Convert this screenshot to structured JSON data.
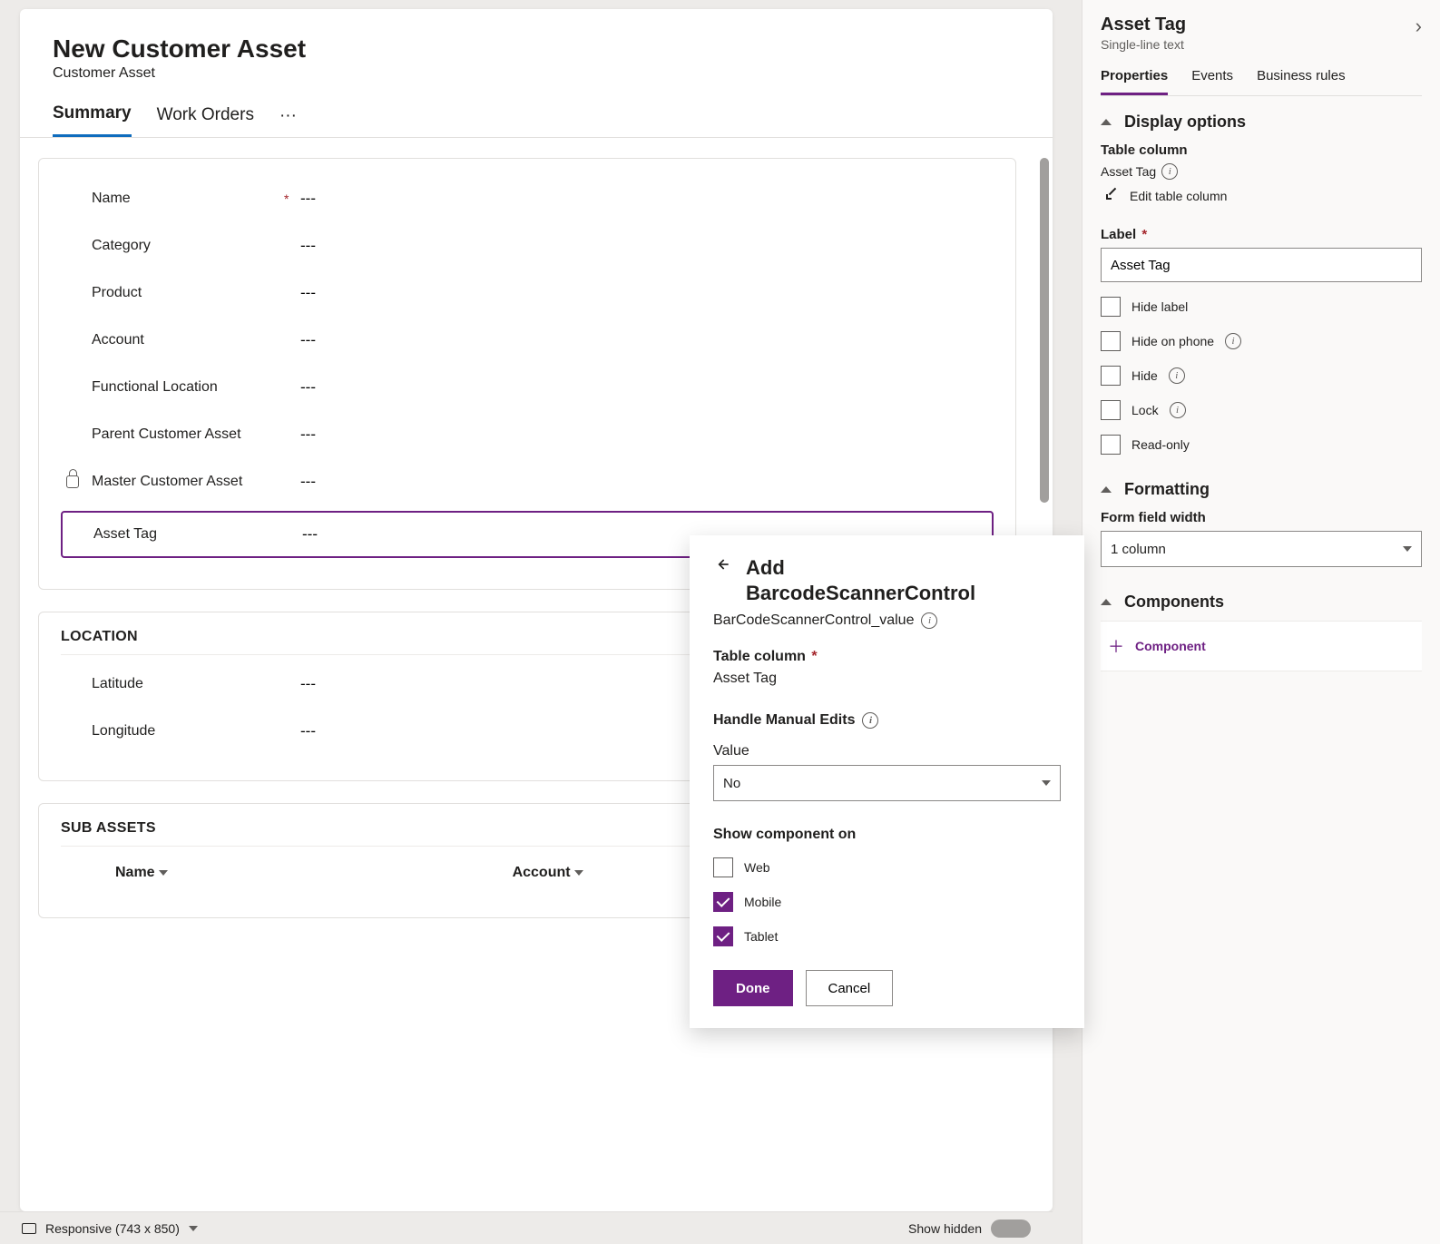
{
  "form": {
    "title": "New Customer Asset",
    "subtitle": "Customer Asset",
    "tabs": {
      "summary": "Summary",
      "work_orders": "Work Orders"
    }
  },
  "fields": {
    "name": {
      "label": "Name",
      "val": "---",
      "required": true
    },
    "category": {
      "label": "Category",
      "val": "---"
    },
    "product": {
      "label": "Product",
      "val": "---"
    },
    "account": {
      "label": "Account",
      "val": "---"
    },
    "functional_location": {
      "label": "Functional Location",
      "val": "---"
    },
    "parent_asset": {
      "label": "Parent Customer Asset",
      "val": "---"
    },
    "master_asset": {
      "label": "Master Customer Asset",
      "val": "---"
    },
    "asset_tag": {
      "label": "Asset Tag",
      "val": "---"
    },
    "latitude": {
      "label": "Latitude",
      "val": "---"
    },
    "longitude": {
      "label": "Longitude",
      "val": "---"
    }
  },
  "sections": {
    "location": "LOCATION",
    "sub_assets": "SUB ASSETS"
  },
  "grid": {
    "name": "Name",
    "account": "Account"
  },
  "status": {
    "responsive": "Responsive (743 x 850)",
    "show_hidden": "Show hidden"
  },
  "rpanel": {
    "title": "Asset Tag",
    "subtitle": "Single-line text",
    "tabs": {
      "properties": "Properties",
      "events": "Events",
      "business_rules": "Business rules"
    },
    "display_options": "Display options",
    "table_column": "Table column",
    "table_column_val": "Asset Tag",
    "edit_table_column": "Edit table column",
    "label_label": "Label",
    "label_val": "Asset Tag",
    "hide_label": "Hide label",
    "hide_on_phone": "Hide on phone",
    "hide": "Hide",
    "lock": "Lock",
    "read_only": "Read-only",
    "formatting": "Formatting",
    "form_field_width": "Form field width",
    "width_val": "1 column",
    "components": "Components",
    "add_component": "Component"
  },
  "popover": {
    "title_pre": "Add",
    "title_main": "BarcodeScannerControl",
    "sub": "BarCodeScannerControl_value",
    "table_column_label": "Table column",
    "table_column_val": "Asset Tag",
    "handle_label": "Handle Manual Edits",
    "value_label": "Value",
    "value_val": "No",
    "show_on": "Show component on",
    "web": "Web",
    "mobile": "Mobile",
    "tablet": "Tablet",
    "done": "Done",
    "cancel": "Cancel"
  }
}
